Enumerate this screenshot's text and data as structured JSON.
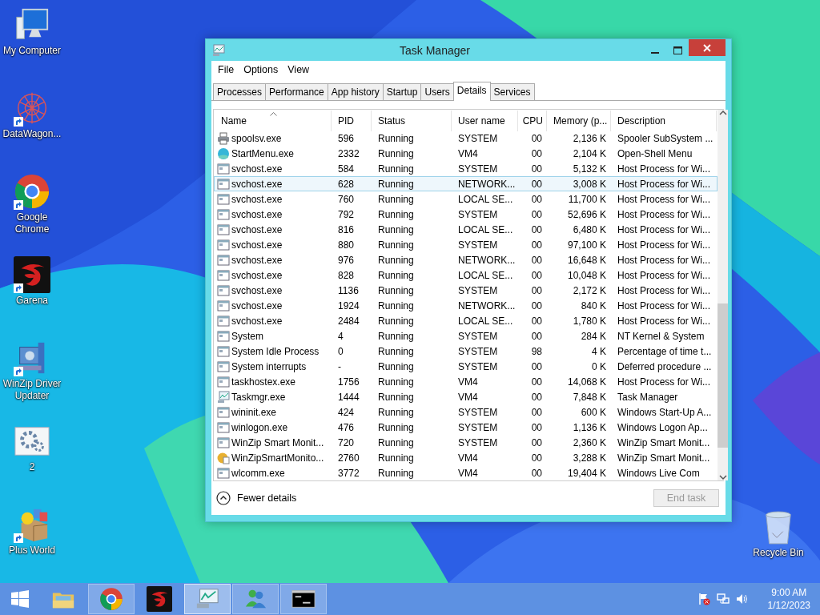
{
  "desktop": {
    "icons": [
      {
        "kind": "computer",
        "label": "My Computer",
        "shortcut": false
      },
      {
        "kind": "pattern",
        "label": "DataWagon...",
        "shortcut": true
      },
      {
        "kind": "browser",
        "label": "Google Chrome",
        "shortcut": true
      },
      {
        "kind": "game",
        "label": "Garena",
        "shortcut": true
      },
      {
        "kind": "clamp",
        "label": "WinZip Driver Updater",
        "shortcut": true
      },
      {
        "kind": "gears",
        "label": "2",
        "shortcut": false
      },
      {
        "kind": "box",
        "label": "Plus World",
        "shortcut": true
      }
    ],
    "recycle_bin": {
      "label": "Recycle Bin"
    }
  },
  "window": {
    "title": "Task Manager",
    "menu": [
      "File",
      "Options",
      "View"
    ],
    "tabs": [
      {
        "label": "Processes",
        "selected": false
      },
      {
        "label": "Performance",
        "selected": false
      },
      {
        "label": "App history",
        "selected": false
      },
      {
        "label": "Startup",
        "selected": false
      },
      {
        "label": "Users",
        "selected": false
      },
      {
        "label": "Details",
        "selected": true
      },
      {
        "label": "Services",
        "selected": false
      }
    ],
    "columns": [
      {
        "label": "Name",
        "sorted": true
      },
      {
        "label": "PID",
        "sorted": false
      },
      {
        "label": "Status",
        "sorted": false
      },
      {
        "label": "User name",
        "sorted": false
      },
      {
        "label": "CPU",
        "sorted": false
      },
      {
        "label": "Memory (p...",
        "sorted": false
      },
      {
        "label": "Description",
        "sorted": false
      }
    ],
    "rows": [
      {
        "kind": "printer",
        "name": "spoolsv.exe",
        "pid": "596",
        "status": "Running",
        "user": "SYSTEM",
        "cpu": "00",
        "memory": "2,136 K",
        "description": "Spooler SubSystem ...",
        "selected": false
      },
      {
        "kind": "globe",
        "name": "StartMenu.exe",
        "pid": "2332",
        "status": "Running",
        "user": "VM4",
        "cpu": "00",
        "memory": "2,104 K",
        "description": "Open-Shell Menu",
        "selected": false
      },
      {
        "kind": "window",
        "name": "svchost.exe",
        "pid": "584",
        "status": "Running",
        "user": "SYSTEM",
        "cpu": "00",
        "memory": "5,132 K",
        "description": "Host Process for Wi...",
        "selected": false
      },
      {
        "kind": "window",
        "name": "svchost.exe",
        "pid": "628",
        "status": "Running",
        "user": "NETWORK...",
        "cpu": "00",
        "memory": "3,008 K",
        "description": "Host Process for Wi...",
        "selected": true
      },
      {
        "kind": "window",
        "name": "svchost.exe",
        "pid": "760",
        "status": "Running",
        "user": "LOCAL SE...",
        "cpu": "00",
        "memory": "11,700 K",
        "description": "Host Process for Wi...",
        "selected": false
      },
      {
        "kind": "window",
        "name": "svchost.exe",
        "pid": "792",
        "status": "Running",
        "user": "SYSTEM",
        "cpu": "00",
        "memory": "52,696 K",
        "description": "Host Process for Wi...",
        "selected": false
      },
      {
        "kind": "window",
        "name": "svchost.exe",
        "pid": "816",
        "status": "Running",
        "user": "LOCAL SE...",
        "cpu": "00",
        "memory": "6,480 K",
        "description": "Host Process for Wi...",
        "selected": false
      },
      {
        "kind": "window",
        "name": "svchost.exe",
        "pid": "880",
        "status": "Running",
        "user": "SYSTEM",
        "cpu": "00",
        "memory": "97,100 K",
        "description": "Host Process for Wi...",
        "selected": false
      },
      {
        "kind": "window",
        "name": "svchost.exe",
        "pid": "976",
        "status": "Running",
        "user": "NETWORK...",
        "cpu": "00",
        "memory": "16,648 K",
        "description": "Host Process for Wi...",
        "selected": false
      },
      {
        "kind": "window",
        "name": "svchost.exe",
        "pid": "828",
        "status": "Running",
        "user": "LOCAL SE...",
        "cpu": "00",
        "memory": "10,048 K",
        "description": "Host Process for Wi...",
        "selected": false
      },
      {
        "kind": "window",
        "name": "svchost.exe",
        "pid": "1136",
        "status": "Running",
        "user": "SYSTEM",
        "cpu": "00",
        "memory": "2,172 K",
        "description": "Host Process for Wi...",
        "selected": false
      },
      {
        "kind": "window",
        "name": "svchost.exe",
        "pid": "1924",
        "status": "Running",
        "user": "NETWORK...",
        "cpu": "00",
        "memory": "840 K",
        "description": "Host Process for Wi...",
        "selected": false
      },
      {
        "kind": "window",
        "name": "svchost.exe",
        "pid": "2484",
        "status": "Running",
        "user": "LOCAL SE...",
        "cpu": "00",
        "memory": "1,780 K",
        "description": "Host Process for Wi...",
        "selected": false
      },
      {
        "kind": "window",
        "name": "System",
        "pid": "4",
        "status": "Running",
        "user": "SYSTEM",
        "cpu": "00",
        "memory": "284 K",
        "description": "NT Kernel & System",
        "selected": false
      },
      {
        "kind": "window",
        "name": "System Idle Process",
        "pid": "0",
        "status": "Running",
        "user": "SYSTEM",
        "cpu": "98",
        "memory": "4 K",
        "description": "Percentage of time t...",
        "selected": false
      },
      {
        "kind": "window",
        "name": "System interrupts",
        "pid": "-",
        "status": "Running",
        "user": "SYSTEM",
        "cpu": "00",
        "memory": "0 K",
        "description": "Deferred procedure ...",
        "selected": false
      },
      {
        "kind": "window",
        "name": "taskhostex.exe",
        "pid": "1756",
        "status": "Running",
        "user": "VM4",
        "cpu": "00",
        "memory": "14,068 K",
        "description": "Host Process for Wi...",
        "selected": false
      },
      {
        "kind": "chart",
        "name": "Taskmgr.exe",
        "pid": "1444",
        "status": "Running",
        "user": "VM4",
        "cpu": "00",
        "memory": "7,848 K",
        "description": "Task Manager",
        "selected": false
      },
      {
        "kind": "window",
        "name": "wininit.exe",
        "pid": "424",
        "status": "Running",
        "user": "SYSTEM",
        "cpu": "00",
        "memory": "600 K",
        "description": "Windows Start-Up A...",
        "selected": false
      },
      {
        "kind": "window",
        "name": "winlogon.exe",
        "pid": "476",
        "status": "Running",
        "user": "SYSTEM",
        "cpu": "00",
        "memory": "1,136 K",
        "description": "Windows Logon Ap...",
        "selected": false
      },
      {
        "kind": "window",
        "name": "WinZip Smart Monit...",
        "pid": "720",
        "status": "Running",
        "user": "SYSTEM",
        "cpu": "00",
        "memory": "2,360 K",
        "description": "WinZip Smart Monit...",
        "selected": false
      },
      {
        "kind": "disc",
        "name": "WinZipSmartMonito...",
        "pid": "2760",
        "status": "Running",
        "user": "VM4",
        "cpu": "00",
        "memory": "3,288 K",
        "description": "WinZip Smart Monit...",
        "selected": false
      },
      {
        "kind": "window",
        "name": "wlcomm.exe",
        "pid": "3772",
        "status": "Running",
        "user": "VM4",
        "cpu": "00",
        "memory": "19,404 K",
        "description": "Windows Live Com",
        "selected": false
      }
    ],
    "fewer_details": "Fewer details",
    "end_task": {
      "label": "End task",
      "disabled": true
    }
  },
  "taskbar": {
    "items": [
      {
        "kind": "folder",
        "running": false,
        "active": false
      },
      {
        "kind": "browser",
        "running": true,
        "active": false
      },
      {
        "kind": "game",
        "running": false,
        "active": false
      },
      {
        "kind": "chart",
        "running": true,
        "active": true
      },
      {
        "kind": "people",
        "running": true,
        "active": false
      },
      {
        "kind": "console",
        "running": true,
        "active": false
      }
    ],
    "tray": [
      {
        "kind": "flag"
      },
      {
        "kind": "network"
      },
      {
        "kind": "speaker"
      }
    ],
    "time": "9:00 AM",
    "date": "1/12/2023"
  }
}
